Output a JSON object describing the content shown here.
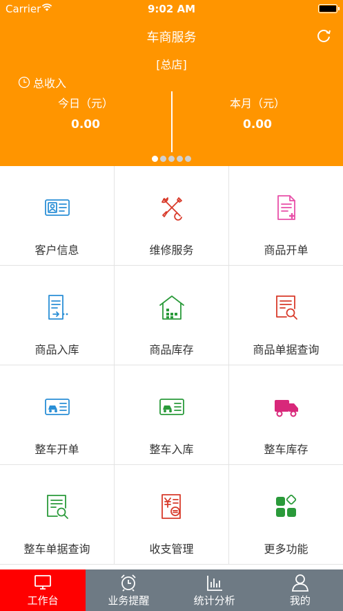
{
  "status_bar": {
    "carrier": "Carrier",
    "time": "9:02 AM"
  },
  "header": {
    "title": "车商服务",
    "store": "[总店]",
    "total_label": "总收入",
    "today_label": "今日（元）",
    "today_value": "0.00",
    "month_label": "本月（元）",
    "month_value": "0.00",
    "page_indicator": {
      "count": 5,
      "current": 1
    }
  },
  "grid": [
    {
      "label": "客户信息",
      "icon": "customer-card-icon",
      "color": "#2a8fd6"
    },
    {
      "label": "维修服务",
      "icon": "wrench-screwdriver-icon",
      "color": "#d83a2a"
    },
    {
      "label": "商品开单",
      "icon": "document-add-icon",
      "color": "#e84fa8"
    },
    {
      "label": "商品入库",
      "icon": "document-inbound-icon",
      "color": "#2a8fd6"
    },
    {
      "label": "商品库存",
      "icon": "warehouse-icon",
      "color": "#2a9a3a"
    },
    {
      "label": "商品单据查询",
      "icon": "document-search-icon",
      "color": "#d83a2a"
    },
    {
      "label": "整车开单",
      "icon": "car-card-icon",
      "color": "#2a8fd6"
    },
    {
      "label": "整车入库",
      "icon": "car-inbound-icon",
      "color": "#2a9a3a"
    },
    {
      "label": "整车库存",
      "icon": "truck-icon",
      "color": "#d8287a"
    },
    {
      "label": "整车单据查询",
      "icon": "document-search-icon",
      "color": "#2a9a3a"
    },
    {
      "label": "收支管理",
      "icon": "ledger-icon",
      "color": "#d83a2a"
    },
    {
      "label": "更多功能",
      "icon": "apps-icon",
      "color": "#2a9a3a"
    }
  ],
  "tabbar": [
    {
      "label": "工作台",
      "icon": "monitor-icon",
      "active": true
    },
    {
      "label": "业务提醒",
      "icon": "alarm-clock-icon",
      "active": false
    },
    {
      "label": "统计分析",
      "icon": "bar-chart-icon",
      "active": false
    },
    {
      "label": "我的",
      "icon": "user-icon",
      "active": false
    }
  ],
  "colors": {
    "header_bg": "#ff9500",
    "tab_active": "#ff0000",
    "tab_bg": "#6e7a84"
  }
}
